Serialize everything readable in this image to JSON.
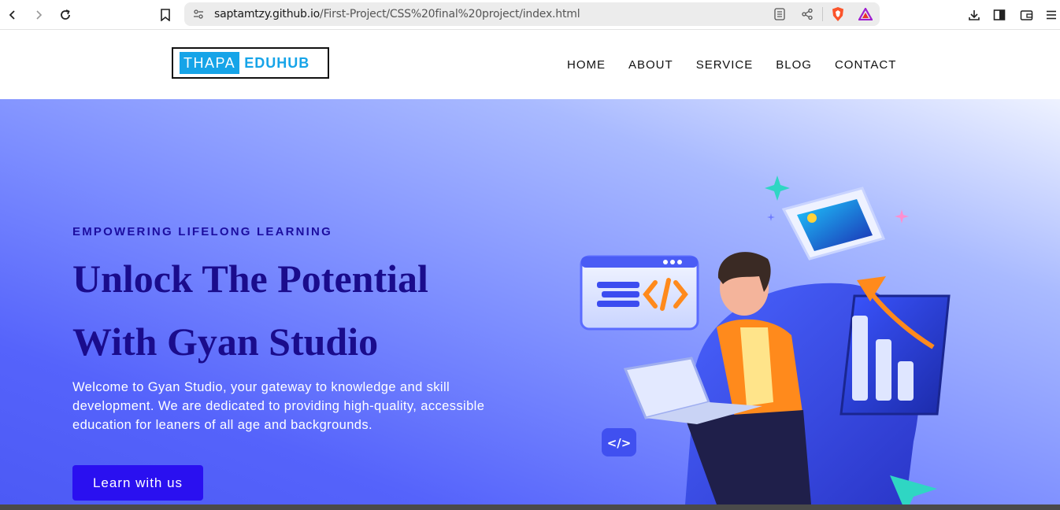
{
  "browser": {
    "url_host": "saptamtzy.github.io",
    "url_path": "/First-Project/CSS%20final%20project/index.html",
    "icons": [
      "back-icon",
      "forward-icon",
      "reload-icon",
      "bookmark-icon",
      "site-info-icon",
      "reader-mode-icon",
      "share-icon",
      "brave-shields-icon",
      "brave-rewards-icon",
      "download-icon",
      "sidebar-icon",
      "wallet-icon",
      "menu-icon"
    ]
  },
  "site": {
    "logo_left": "THAPA",
    "logo_right": "EDUHUB",
    "nav": [
      "HOME",
      "ABOUT",
      "SERVICE",
      "BLOG",
      "CONTACT"
    ]
  },
  "hero": {
    "tagline": "EMPOWERING LIFELONG LEARNING",
    "headline_line1": "Unlock The Potential",
    "headline_line2": "With Gyan Studio",
    "description": "Welcome to Gyan Studio, your gateway to knowledge and skill development. We are dedicated to providing high-quality, accessible education for leaners of all age and backgrounds.",
    "cta": "Learn with us",
    "illustration": "3d-student-laptop-illustration"
  },
  "colors": {
    "accent": "#16a4e8",
    "heading": "#1a0c8c",
    "button": "#2a10f0",
    "hero_gradient_dark": "#4c5af5",
    "hero_gradient_light": "#eef2ff"
  }
}
